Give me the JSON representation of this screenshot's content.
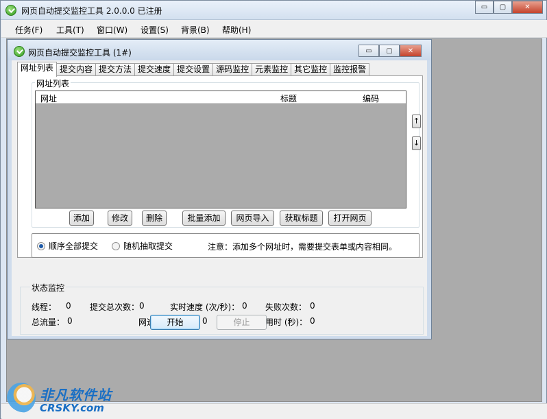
{
  "app": {
    "title": "网页自动提交监控工具 2.0.0.0  已注册",
    "window_buttons": {
      "minimize": "▭",
      "restore": "▢",
      "close": "✕"
    }
  },
  "menu": [
    "任务(F)",
    "工具(T)",
    "窗口(W)",
    "设置(S)",
    "背景(B)",
    "帮助(H)"
  ],
  "child": {
    "title": "网页自动提交监控工具 (1#)",
    "tabs": [
      "网址列表",
      "提交内容",
      "提交方法",
      "提交速度",
      "提交设置",
      "源码监控",
      "元素监控",
      "其它监控",
      "监控报警"
    ],
    "url_group": {
      "title": "网址列表",
      "columns": [
        "网址",
        "标题",
        "编码"
      ],
      "up_arrow": "↑",
      "down_arrow": "↓",
      "buttons": [
        "添加",
        "修改",
        "删除",
        "批量添加",
        "网页导入",
        "获取标题",
        "打开网页"
      ]
    },
    "submit_mode": {
      "option1": "顺序全部提交",
      "option2": "随机抽取提交",
      "selected": "顺序全部提交",
      "note": "注意：添加多个网址时，需要提交表单或内容相同。"
    },
    "status": {
      "title": "状态监控",
      "threads_label": "线程：",
      "threads_value": "0",
      "total_submits_label": "提交总次数：",
      "total_submits_value": "0",
      "realtime_speed_label": "实时速度 (次/秒)：",
      "realtime_speed_value": "0",
      "failures_label": "失败次数：",
      "failures_value": "0",
      "total_traffic_label": "总流量：",
      "total_traffic_value": "0",
      "net_speed_label": "网速 (比特/秒)：",
      "net_speed_value": "0",
      "elapsed_label": "用时 (秒)：",
      "elapsed_value": "0"
    },
    "start_button": "开始",
    "stop_button": "停止"
  },
  "watermark": {
    "line1": "非凡软件站",
    "line2": "CRSKY.com"
  }
}
